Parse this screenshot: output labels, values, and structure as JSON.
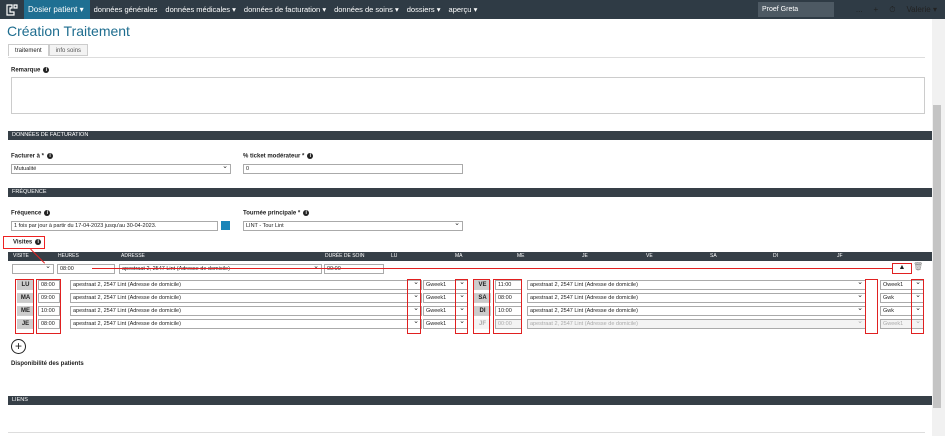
{
  "nav": {
    "brand": "Dosier patient",
    "menu": [
      "données générales",
      "données médicales",
      "données de facturation",
      "données de soins",
      "dossiers",
      "aperçu"
    ],
    "user_box": "Proef Greta",
    "more": "...",
    "plus": "+",
    "user": "Valerie"
  },
  "page": {
    "title": "Création Traitement",
    "tabs": [
      "traitement",
      "info soins"
    ]
  },
  "remarque": {
    "label": "Remarque"
  },
  "facturation": {
    "section": "DONNÉES DE FACTURATION",
    "facturer_label": "Facturer à *",
    "facturer_value": "Mutualité",
    "ticket_label": "% ticket modérateur *",
    "ticket_value": "0"
  },
  "frequence": {
    "section": "FRÉQUENCE",
    "freq_label": "Fréquence",
    "freq_value": "1 fois par jour à partir du 17-04-2023 jusqu'au 30-04-2023.",
    "tournee_label": "Tournée principale *",
    "tournee_value": "LINT - Tour Lint"
  },
  "visites": {
    "label": "Visites",
    "headers": [
      "VISITE",
      "HEURES",
      "ADRESSE",
      "DURÉE DE SOIN",
      "LU",
      "MA",
      "ME",
      "JE",
      "VE",
      "SA",
      "DI",
      "JF"
    ],
    "row1": {
      "time": "08:00",
      "address": "apestraat 2, 2547 Lint (Adresse de domicile)",
      "duration": "00:00"
    },
    "left_days": [
      {
        "day": "LU",
        "time": "08:00",
        "address": "apestraat 2, 2547 Lint (Adresse de domicile)",
        "week": "Gweek1"
      },
      {
        "day": "MA",
        "time": "09:00",
        "address": "apestraat 2, 2547 Lint (Adresse de domicile)",
        "week": "Gweek1"
      },
      {
        "day": "ME",
        "time": "10:00",
        "address": "apestraat 2, 2547 Lint (Adresse de domicile)",
        "week": "Gweek1"
      },
      {
        "day": "JE",
        "time": "08:00",
        "address": "apestraat 2, 2547 Lint (Adresse de domicile)",
        "week": "Gweek1"
      }
    ],
    "right_days": [
      {
        "day": "VE",
        "time": "11:00",
        "address": "apestraat 2, 2547 Lint (Adresse de domicile)",
        "week": "Oweek1"
      },
      {
        "day": "SA",
        "time": "08:00",
        "address": "apestraat 2, 2547 Lint (Adresse de domicile)",
        "week": "Gwk"
      },
      {
        "day": "DI",
        "time": "10:00",
        "address": "apestraat 2, 2547 Lint (Adresse de domicile)",
        "week": "Gwk"
      },
      {
        "day": "JF",
        "time": "00:00",
        "address": "apestraat 2, 2547 Lint (Adresse de domicile)",
        "week": "Gweek1"
      }
    ]
  },
  "dispo": {
    "label": "Disponibilité des patients"
  },
  "liens": {
    "section": "LIENS"
  }
}
